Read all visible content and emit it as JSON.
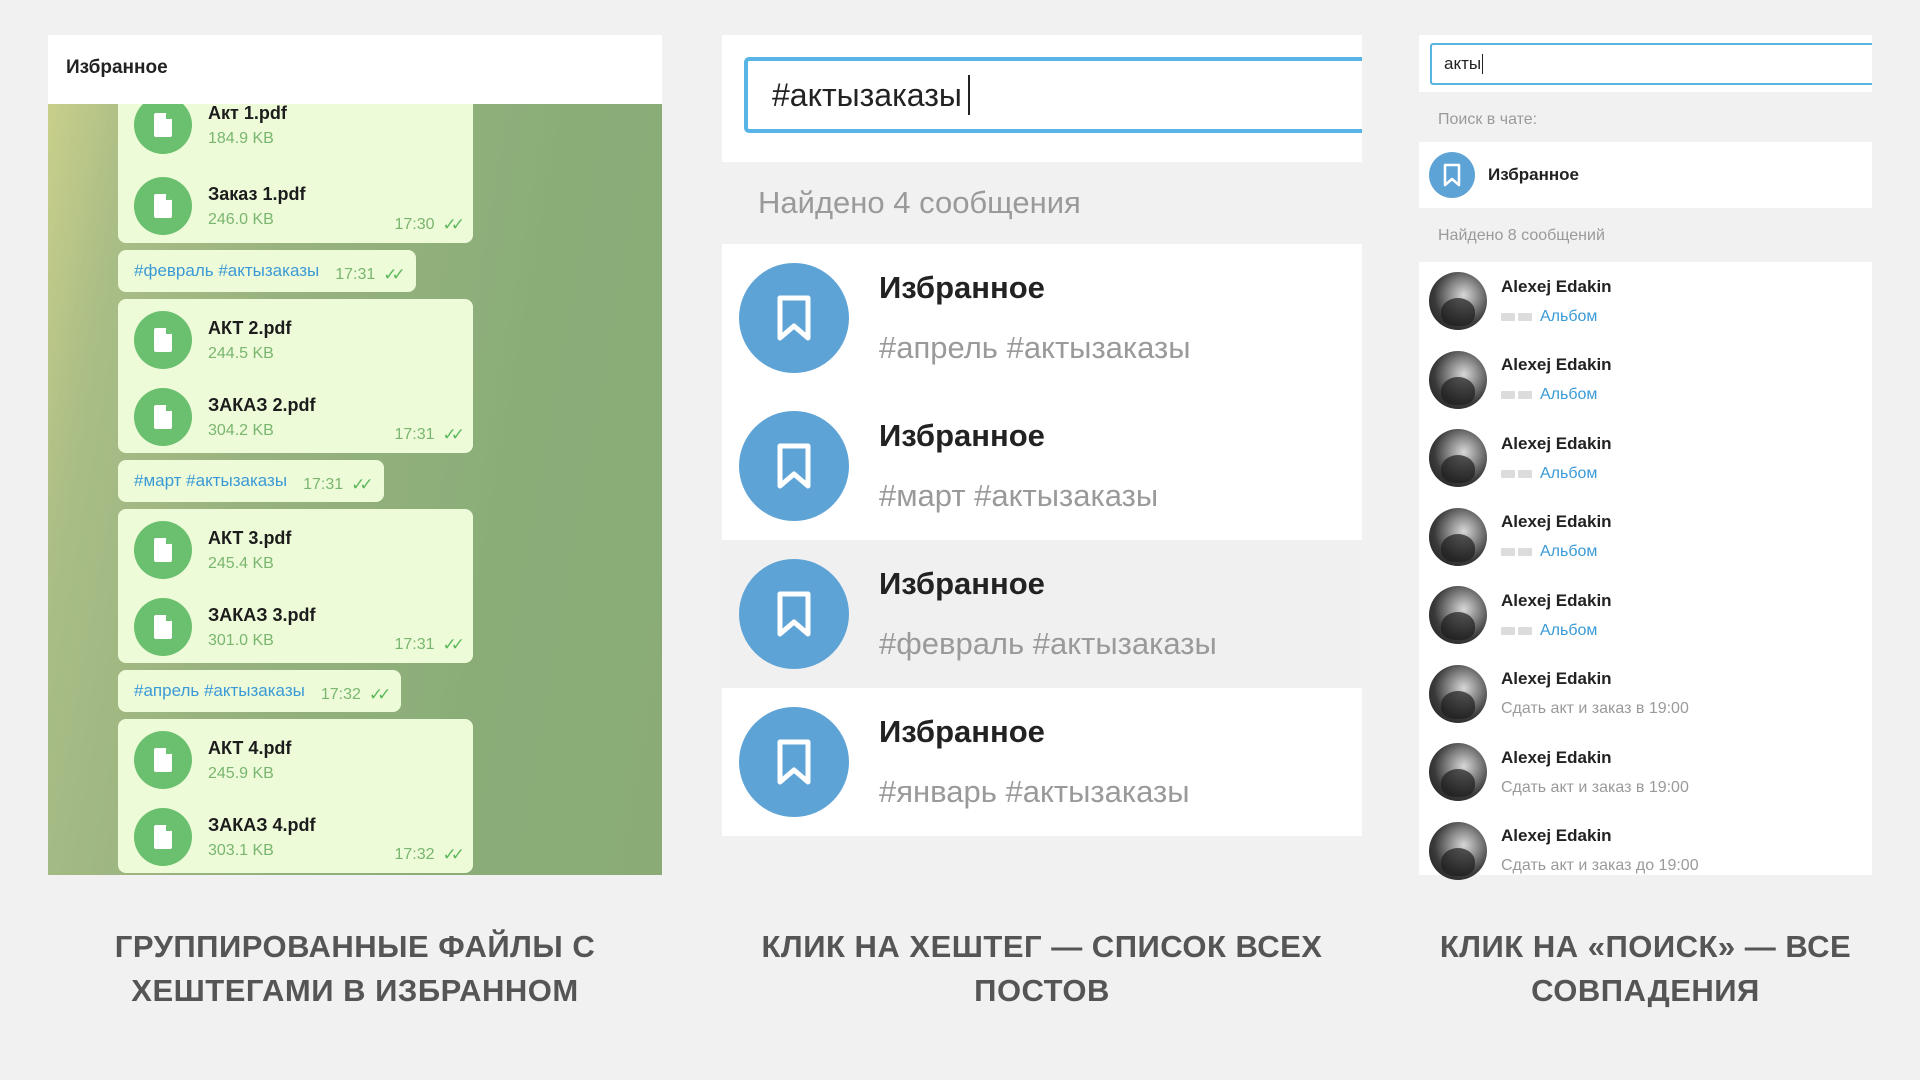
{
  "panel1": {
    "header_title": "Избранное",
    "messages": [
      {
        "type": "files",
        "files": [
          {
            "name": "Акт 1.pdf",
            "size": "184.9 KB"
          },
          {
            "name": "Заказ 1.pdf",
            "size": "246.0 KB"
          }
        ],
        "time": "17:30"
      },
      {
        "type": "tag",
        "text": "#февраль #актызаказы",
        "time": "17:31"
      },
      {
        "type": "files",
        "files": [
          {
            "name": "АКТ 2.pdf",
            "size": "244.5 KB"
          },
          {
            "name": "ЗАКАЗ 2.pdf",
            "size": "304.2 KB"
          }
        ],
        "time": "17:31"
      },
      {
        "type": "tag",
        "text": "#март #актызаказы",
        "time": "17:31"
      },
      {
        "type": "files",
        "files": [
          {
            "name": "АКТ 3.pdf",
            "size": "245.4 KB"
          },
          {
            "name": "ЗАКАЗ 3.pdf",
            "size": "301.0 KB"
          }
        ],
        "time": "17:31"
      },
      {
        "type": "tag",
        "text": "#апрель #актызаказы",
        "time": "17:32"
      },
      {
        "type": "files",
        "files": [
          {
            "name": "АКТ 4.pdf",
            "size": "245.9 KB"
          },
          {
            "name": "ЗАКАЗ 4.pdf",
            "size": "303.1 KB"
          }
        ],
        "time": "17:32"
      }
    ],
    "colors": {
      "bubble": "#eefbd9",
      "file_icon": "#6ac06e",
      "hashtag": "#3b9ad6"
    }
  },
  "panel2": {
    "search_value": "#актызаказы",
    "found_label": "Найдено 4 сообщения",
    "results": [
      {
        "title": "Избранное",
        "text": "#апрель #актызаказы"
      },
      {
        "title": "Избранное",
        "text": "#март #актызаказы"
      },
      {
        "title": "Избранное",
        "text": "#февраль #актызаказы"
      },
      {
        "title": "Избранное",
        "text": "#январь #актызаказы"
      }
    ],
    "colors": {
      "input_border": "#58b4e4",
      "avatar": "#5ea3d6"
    }
  },
  "panel3": {
    "search_value": "акты",
    "chat_section_label": "Поиск в чате:",
    "chat_name": "Избранное",
    "found_label": "Найдено 8 сообщений",
    "results": [
      {
        "name": "Alexej Edakin",
        "preview": "Альбом",
        "kind": "album"
      },
      {
        "name": "Alexej Edakin",
        "preview": "Альбом",
        "kind": "album"
      },
      {
        "name": "Alexej Edakin",
        "preview": "Альбом",
        "kind": "album"
      },
      {
        "name": "Alexej Edakin",
        "preview": "Альбом",
        "kind": "album"
      },
      {
        "name": "Alexej Edakin",
        "preview": "Альбом",
        "kind": "album"
      },
      {
        "name": "Alexej Edakin",
        "preview": "Сдать акт и заказ в 19:00",
        "kind": "text"
      },
      {
        "name": "Alexej Edakin",
        "preview": "Сдать акт и заказ в 19:00",
        "kind": "text"
      },
      {
        "name": "Alexej Edakin",
        "preview": "Сдать акт и заказ до 19:00",
        "kind": "text"
      }
    ]
  },
  "captions": {
    "caption1": "ГРУППИРОВАННЫЕ ФАЙЛЫ С ХЕШТЕГАМИ В ИЗБРАННОМ",
    "caption2": "КЛИК НА ХЕШТЕГ — СПИСОК ВСЕХ ПОСТОВ",
    "caption3": "КЛИК НА «ПОИСК» — ВСЕ СОВПАДЕНИЯ"
  },
  "icons": {
    "file": "document-icon",
    "bookmark": "bookmark-icon",
    "read": "double-check-icon",
    "album": "photo-thumbnail-icon"
  }
}
